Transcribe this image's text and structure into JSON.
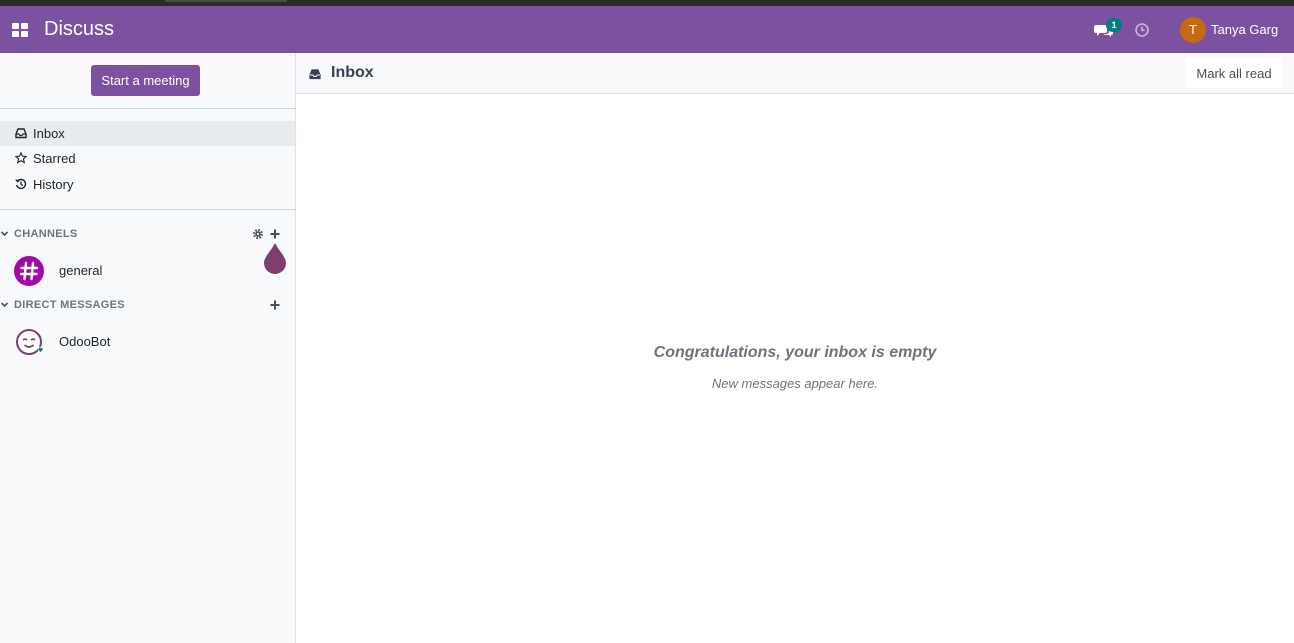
{
  "navbar": {
    "app_title": "Discuss",
    "apps_icon": "apps-grid-icon",
    "chat_icon": "chat-bubbles-icon",
    "chat_badge_count": "1",
    "activity_icon": "clock-icon",
    "user_initial": "T",
    "user_name": "Tanya Garg",
    "color": "#7c519f"
  },
  "sidebar": {
    "start_meeting_label": "Start a meeting",
    "mailboxes": [
      {
        "label": "Inbox",
        "icon": "inbox-icon",
        "active": true
      },
      {
        "label": "Starred",
        "icon": "star-icon",
        "active": false
      },
      {
        "label": "History",
        "icon": "history-icon",
        "active": false
      }
    ],
    "channels_label": "CHANNELS",
    "channels": [
      {
        "name": "general",
        "icon": "hash-icon"
      }
    ],
    "direct_messages_label": "DIRECT MESSAGES",
    "direct_messages": [
      {
        "name": "OdooBot",
        "icon": "odoobot-icon",
        "status": "online"
      }
    ]
  },
  "main": {
    "title": "Inbox",
    "title_icon": "inbox-icon",
    "mark_all_read_label": "Mark all read",
    "empty_title": "Congratulations, your inbox is empty",
    "empty_subtitle": "New messages appear here."
  },
  "colors": {
    "primary": "#7c519f",
    "badge": "#017e84",
    "channel_avatar": "#a10aa6"
  }
}
